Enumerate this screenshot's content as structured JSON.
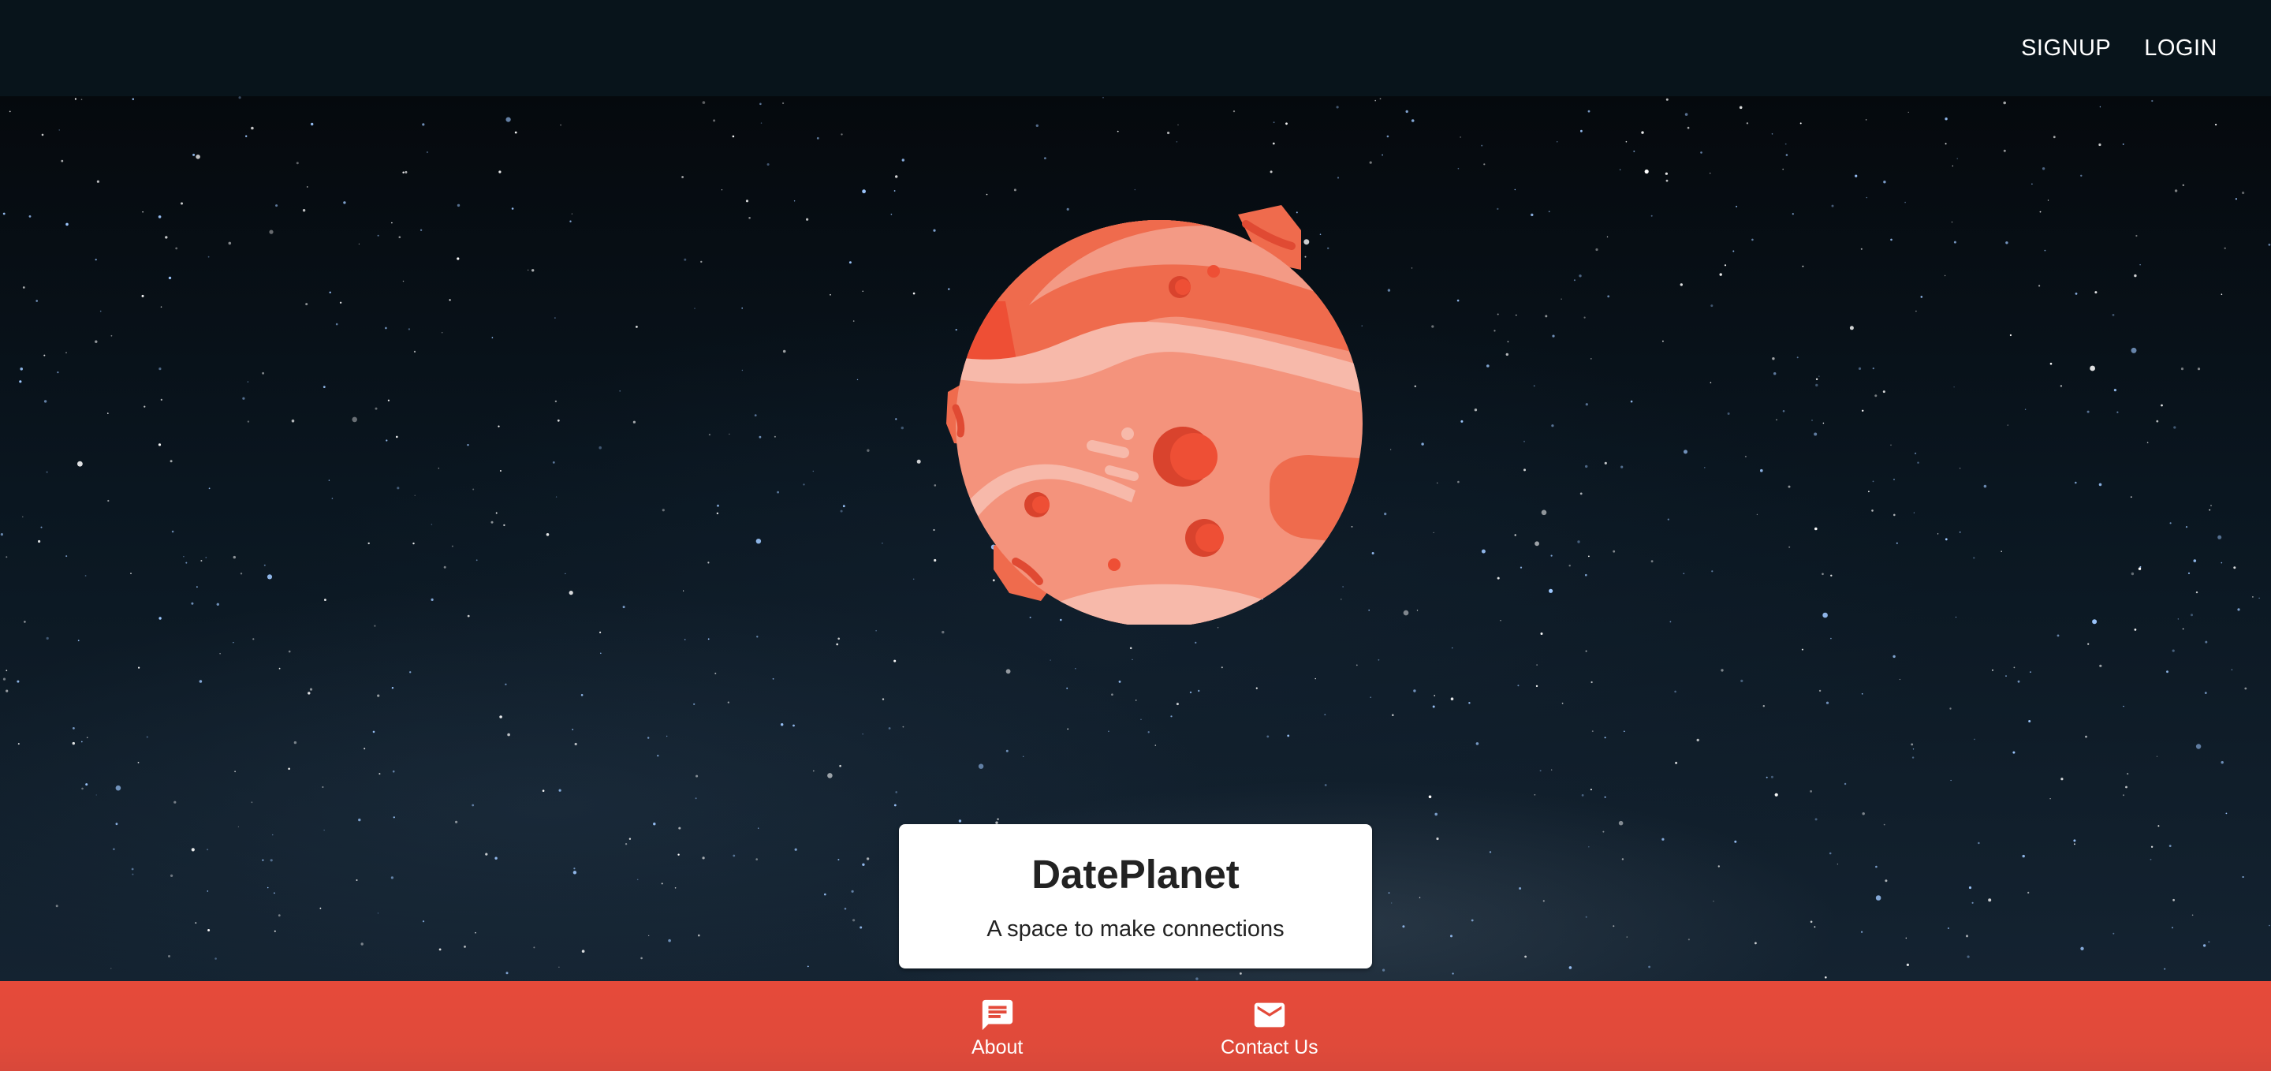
{
  "nav": {
    "signup_label": "SIGNUP",
    "login_label": "LOGIN"
  },
  "hero": {
    "title": "DatePlanet",
    "subtitle": "A space to make connections"
  },
  "bottom_nav": {
    "about_label": "About",
    "contact_label": "Contact Us"
  },
  "icons": {
    "about": "chat-message-icon",
    "contact": "mail-envelope-icon",
    "hero_image": "planet-illustration"
  },
  "colors": {
    "topbar": "#08141b",
    "bottombar": "#e14b3a",
    "planet_light": "#f4937c",
    "planet_mid": "#ef6b4d",
    "planet_dark": "#d9432d",
    "card_bg": "#ffffff",
    "text_dark": "#222222"
  }
}
